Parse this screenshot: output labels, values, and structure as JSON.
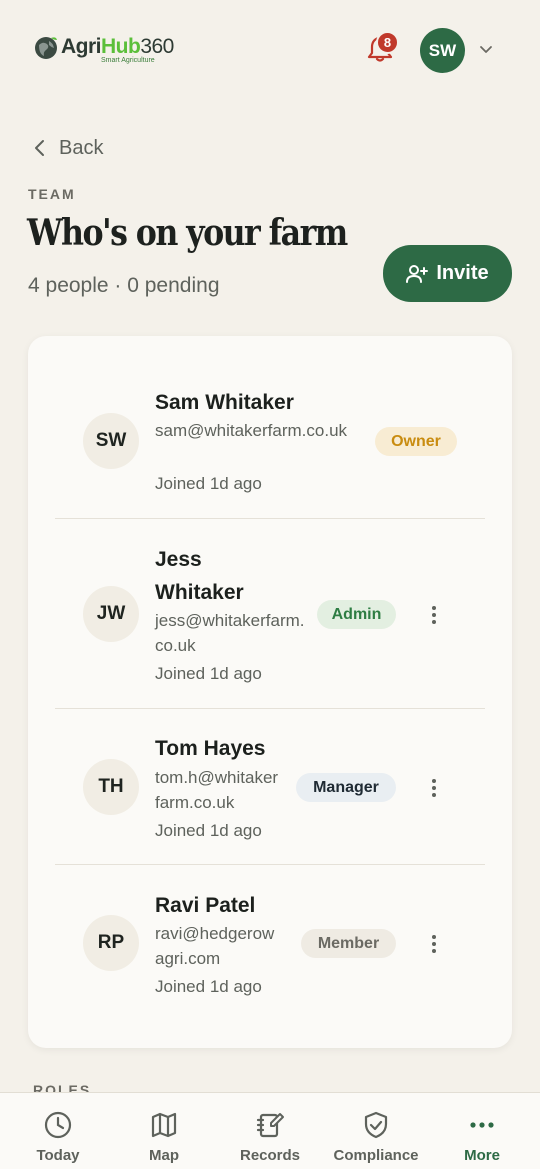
{
  "brand": {
    "name_part1": "Agri",
    "name_part2": "Hub",
    "name_part3": "360",
    "tagline": "Smart Agriculture",
    "accent": "#2d6a45"
  },
  "header": {
    "notification_count": "8",
    "user_initials": "SW"
  },
  "nav": {
    "back_label": "Back"
  },
  "page": {
    "eyebrow": "TEAM",
    "title": "Who's on your farm",
    "subtitle": "4 people · 0 pending",
    "invite_label": "Invite"
  },
  "members": [
    {
      "initials": "SW",
      "name": "Sam Whitaker",
      "email": "sam@whitakerfarm.co.uk",
      "joined": "Joined 1d ago",
      "role": "Owner"
    },
    {
      "initials": "JW",
      "name": "Jess Whitaker",
      "email": "jess@whitakerfarm.co.uk",
      "joined": "Joined 1d ago",
      "role": "Admin"
    },
    {
      "initials": "TH",
      "name": "Tom Hayes",
      "email": "tom.h@whitakerfarm.co.uk",
      "joined": "Joined 1d ago",
      "role": "Manager"
    },
    {
      "initials": "RP",
      "name": "Ravi Patel",
      "email": "ravi@hedgerowagri.com",
      "joined": "Joined 1d ago",
      "role": "Member"
    }
  ],
  "roles_section": {
    "heading": "ROLES"
  },
  "bottom_nav": [
    {
      "label": "Today",
      "icon": "clock-icon"
    },
    {
      "label": "Map",
      "icon": "map-icon"
    },
    {
      "label": "Records",
      "icon": "notebook-icon"
    },
    {
      "label": "Compliance",
      "icon": "shield-check-icon"
    },
    {
      "label": "More",
      "icon": "more-dots-icon",
      "active": true
    }
  ]
}
